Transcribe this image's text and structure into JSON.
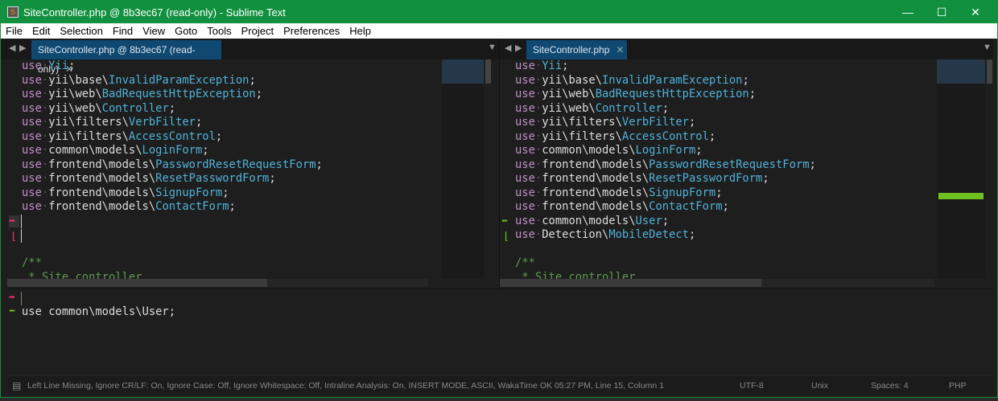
{
  "window": {
    "title": "SiteController.php @ 8b3ec67 (read-only) - Sublime Text",
    "minimize": "—",
    "maximize": "☐",
    "close": "✕"
  },
  "menu": [
    "File",
    "Edit",
    "Selection",
    "Find",
    "View",
    "Goto",
    "Tools",
    "Project",
    "Preferences",
    "Help"
  ],
  "left": {
    "tab": "SiteController.php @ 8b3ec67 (read-only)",
    "tab_close": "✕",
    "lines": [
      [
        "use",
        "",
        "Yii"
      ],
      [
        "use",
        "yii\\base\\",
        "InvalidParamException"
      ],
      [
        "use",
        "yii\\web\\",
        "BadRequestHttpException"
      ],
      [
        "use",
        "yii\\web\\",
        "Controller"
      ],
      [
        "use",
        "yii\\filters\\",
        "VerbFilter"
      ],
      [
        "use",
        "yii\\filters\\",
        "AccessControl"
      ],
      [
        "use",
        "common\\models\\",
        "LoginForm"
      ],
      [
        "use",
        "frontend\\models\\",
        "PasswordResetRequestForm"
      ],
      [
        "use",
        "frontend\\models\\",
        "ResetPasswordForm"
      ],
      [
        "use",
        "frontend\\models\\",
        "SignupForm"
      ],
      [
        "use",
        "frontend\\models\\",
        "ContactForm"
      ]
    ],
    "comment": "/**",
    "comment2": " * Site controller"
  },
  "right": {
    "tab": "SiteController.php",
    "tab_close": "✕",
    "lines": [
      [
        "use",
        "",
        "Yii"
      ],
      [
        "use",
        "yii\\base\\",
        "InvalidParamException"
      ],
      [
        "use",
        "yii\\web\\",
        "BadRequestHttpException"
      ],
      [
        "use",
        "yii\\web\\",
        "Controller"
      ],
      [
        "use",
        "yii\\filters\\",
        "VerbFilter"
      ],
      [
        "use",
        "yii\\filters\\",
        "AccessControl"
      ],
      [
        "use",
        "common\\models\\",
        "LoginForm"
      ],
      [
        "use",
        "frontend\\models\\",
        "PasswordResetRequestForm"
      ],
      [
        "use",
        "frontend\\models\\",
        "ResetPasswordForm"
      ],
      [
        "use",
        "frontend\\models\\",
        "SignupForm"
      ],
      [
        "use",
        "frontend\\models\\",
        "ContactForm"
      ],
      [
        "use",
        "common\\models\\",
        "User"
      ],
      [
        "use",
        "Detection\\",
        "MobileDetect"
      ]
    ],
    "comment": "/**",
    "comment2": " * Site controller"
  },
  "bottom": {
    "line": "use common\\models\\User;"
  },
  "status": {
    "message": "Left Line Missing, Ignore CR/LF: On, Ignore Case: Off, Ignore Whitespace: Off, Intraline Analysis: On, INSERT MODE, ASCII, WakaTime OK 05:27 PM, Line 15, Column 1",
    "encoding": "UTF-8",
    "line_endings": "Unix",
    "indent": "Spaces: 4",
    "syntax": "PHP"
  },
  "colors": {
    "titlebar": "#11913f",
    "tab": "#0f4870",
    "removed": "#ff2d78",
    "added": "#6ec11f"
  }
}
